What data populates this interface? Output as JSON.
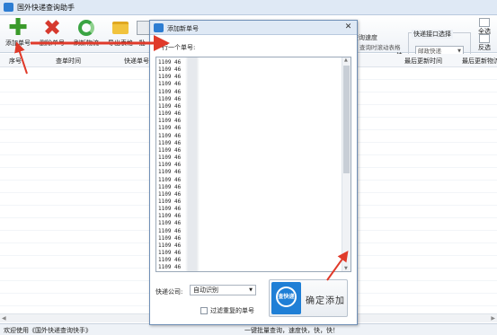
{
  "app": {
    "title": "国外快递查询助手",
    "icon": "app-icon"
  },
  "toolbar": {
    "add": "添加单号",
    "delete": "删除单号",
    "refresh": "刷新物流",
    "export": "导出表格",
    "fifth": "批"
  },
  "speed": {
    "label": "查询速度",
    "realtime": "查询时滚动表格",
    "fast": "快",
    "level": 0.65
  },
  "interface": {
    "legend": "快递接口选择",
    "selected": "邮政快递"
  },
  "side_buttons": {
    "select_all": "全选",
    "invert": "反选"
  },
  "grid": {
    "columns": [
      "序号",
      "查单时间",
      "快递单号",
      "最后更新时间",
      "最后更新物流"
    ]
  },
  "status": {
    "left": "欢迎使用《国外快递查询快手》",
    "mid": "一键批量查询，速度快，快，快！"
  },
  "dialog": {
    "title": "添加新单号",
    "hint": "一行一个单号:",
    "tracking_numbers": [
      "1109 46",
      "1109 46",
      "1109 46",
      "1109 46",
      "1109 46",
      "1109 46",
      "1109 46",
      "1109 46",
      "1109 46",
      "1109 46",
      "1109 46",
      "1109 46",
      "1109 46",
      "1109 46",
      "1109 46",
      "1109 46",
      "1109 46",
      "1109 46",
      "1109 46",
      "1109 46",
      "1109 46",
      "1109 46",
      "1109 46",
      "1109 46",
      "1109 46",
      "1109 46",
      "1109 46",
      "1109 46",
      "1109 46",
      "1109 46",
      "1109 46",
      "1109 46",
      "1109 46",
      "1109 46",
      "1109 46",
      "1109 46",
      "1109 46",
      "1109 46",
      "1109 46",
      "1109 46",
      "1109 46",
      "1109 46",
      "1109 46",
      "1109 46",
      "1109 46",
      "1109 46",
      "1109 46",
      "1109 46",
      "1109 46",
      "1109 46",
      "1109 46",
      "1109 46",
      "1109 46",
      "1109 46",
      "1109 46",
      "1109 46",
      "1109 46",
      "1109 46",
      "1109 46",
      "1109 46",
      "1109 46",
      "1109 46",
      "1109 46",
      "1109 46",
      "1109 46",
      "1109 46",
      "1109 46",
      "1109 46",
      "1109 46",
      "1109 46",
      "1109 46",
      "1109 46",
      "1109 46",
      "1109 46",
      "1109 46",
      "1109 46",
      "1109 46",
      "1109 46",
      "1109 46",
      "1109 46",
      "1109 46",
      "1109 46",
      "1109 46",
      "1109 46",
      "1109 46",
      "1109 46",
      "1109 46",
      "1109 46",
      "1109 46",
      "1109 46",
      "1109 46",
      "1109 46",
      "1109 46",
      "1109 46",
      "1109 46",
      "1109 46",
      "1109 46",
      "1109 46",
      "1109 46",
      "1109 46",
      "1109 46",
      "1109 46",
      "1109 46",
      "1109 46",
      "1109 46",
      "1109 46",
      "1109 46",
      "1109 46",
      "1109 46",
      "1109 46",
      "1109 46",
      "1109 46",
      "1109 46",
      "1109 46",
      "1109 46",
      "1109 46",
      "1109 46",
      "1109 46",
      "1109 46",
      "1109 46",
      "1109 46",
      "1109 46",
      "1109 46",
      "1109 46",
      "1109 46",
      "1109 46",
      "1109 46",
      "1109 46",
      "1109 46",
      "1109 46",
      "1109 46",
      "1109 46",
      "1109 46",
      "1109 46",
      "1109 46",
      "1109 46",
      "1109 46",
      "1109 46",
      "1109 46",
      "1109 46",
      "1109 46",
      "1109 46",
      "1109 46",
      "1109 46",
      "1109 46",
      "1109 46",
      "1109 46",
      "1109 46",
      "1109 46",
      "1109 46",
      "1109 46",
      "1109 46",
      "1109 46",
      "1109 46",
      "1109 46",
      "1109 46",
      "1109 46",
      "1109 46",
      "1109 46",
      "1109 46",
      "1109 46",
      "1109 46",
      "1109 46",
      "1109 46",
      "1109 46",
      "1109 46",
      "1109 46",
      "1109 46"
    ],
    "company_label": "快递公司:",
    "company_selected": "自动识别",
    "dedupe_label": "过滤重复的单号",
    "logo_text": "查快递",
    "confirm": "确定添加"
  },
  "colors": {
    "accent": "#2d7dd2",
    "annotation": "#e03a2a"
  }
}
